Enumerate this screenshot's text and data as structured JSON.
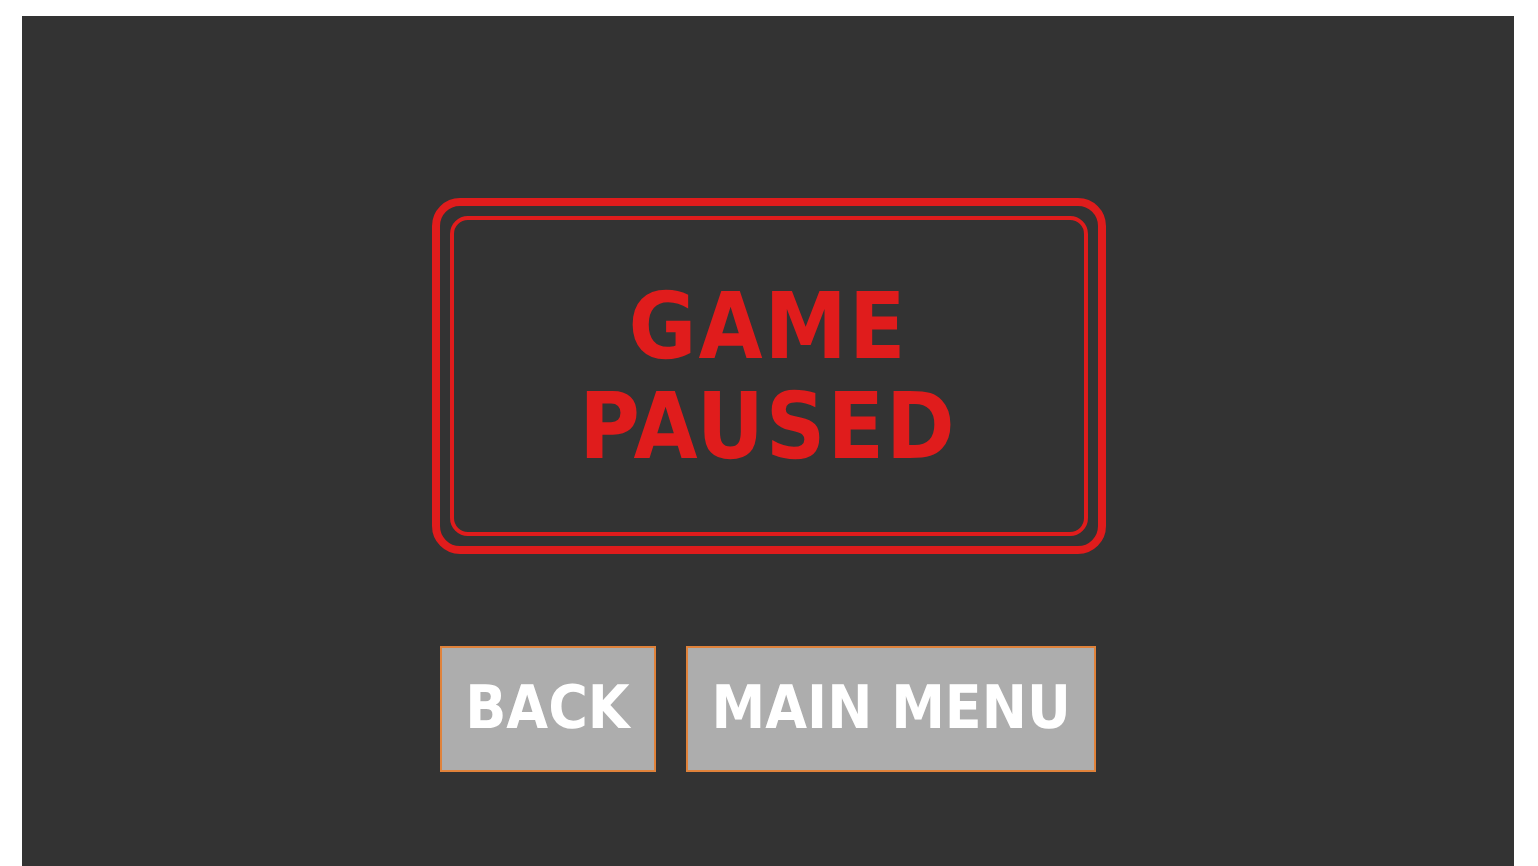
{
  "title": {
    "lines": [
      "GAME",
      "PAUSED"
    ]
  },
  "buttons": [
    {
      "label": "BACK"
    },
    {
      "label": "MAIN MENU"
    }
  ]
}
